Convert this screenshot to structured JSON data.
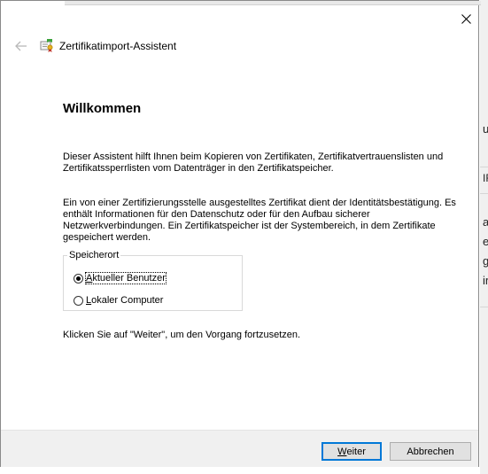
{
  "window": {
    "title": "Zertifikatimport-Assistent",
    "back_icon": "arrow-left-icon",
    "close_icon": "close-icon",
    "app_icon": "certificate-icon"
  },
  "main": {
    "heading": "Willkommen",
    "intro": "Dieser Assistent hilft Ihnen beim Kopieren von Zertifikaten, Zertifikatvertrauenslisten und Zertifikatssperrlisten vom Datenträger in den Zertifikatspeicher.",
    "description": "Ein von einer Zertifizierungsstelle ausgestelltes Zertifikat dient der Identitätsbestätigung. Es enthält Informationen für den Datenschutz oder für den Aufbau sicherer Netzwerkverbindungen. Ein Zertifikatspeicher ist der Systembereich, in dem Zertifikate gespeichert werden.",
    "storage": {
      "legend": "Speicherort",
      "options": [
        {
          "label_key": "A",
          "label_rest": "ktueller Benutzer",
          "selected": true
        },
        {
          "label_key": "L",
          "label_rest": "okaler Computer",
          "selected": false
        }
      ]
    },
    "continue_hint": "Klicken Sie auf \"Weiter\", um den Vorgang fortzusetzen."
  },
  "footer": {
    "next_key": "W",
    "next_rest": "eiter",
    "cancel_label": "Abbrechen"
  },
  "backdrop": {
    "fragments": [
      "u",
      "IF",
      "a",
      "e-",
      "g",
      "ir"
    ]
  }
}
